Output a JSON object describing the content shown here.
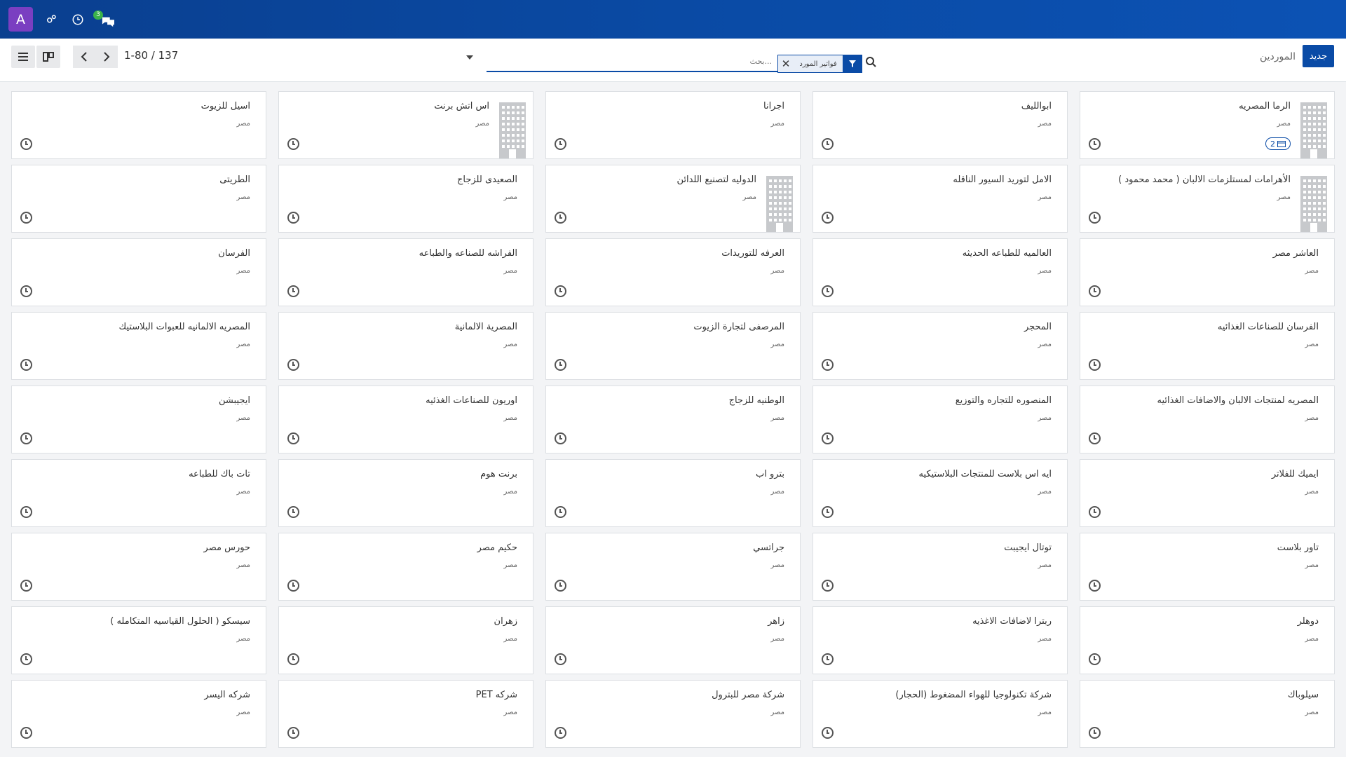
{
  "navbar": {
    "avatar_letter": "A",
    "message_count": "3"
  },
  "control": {
    "new_button": "جديد",
    "breadcrumb": "الموردين",
    "pager_value": "1-80 / 137",
    "search_placeholder": "بحث...",
    "facet_label": "فواتير المورد"
  },
  "card_default_subtitle": "مصر",
  "cards": [
    {
      "title": "الرما المصريه",
      "subtitle": "مصر",
      "has_image": true,
      "badge": "2"
    },
    {
      "title": "ابوالليف",
      "subtitle": "مصر",
      "has_image": false
    },
    {
      "title": "اجرانا",
      "subtitle": "مصر",
      "has_image": false
    },
    {
      "title": "اس اتش برنت",
      "subtitle": "مصر",
      "has_image": true
    },
    {
      "title": "اسيل للزيوت",
      "subtitle": "مصر",
      "has_image": false
    },
    {
      "title": "الأهرامات لمستلزمات الالبان ( محمد محمود )",
      "subtitle": "مصر",
      "has_image": true
    },
    {
      "title": "الامل لتوريد السيور الناقله",
      "subtitle": "مصر",
      "has_image": false
    },
    {
      "title": "الدوليه لتصنيع اللدائن",
      "subtitle": "مصر",
      "has_image": true
    },
    {
      "title": "الصعيدى للزجاج",
      "subtitle": "مصر",
      "has_image": false
    },
    {
      "title": "الطريتى",
      "subtitle": "مصر",
      "has_image": false
    },
    {
      "title": "العاشر مصر",
      "subtitle": "مصر",
      "has_image": false
    },
    {
      "title": "العالميه للطباعه الحديثه",
      "subtitle": "مصر",
      "has_image": false
    },
    {
      "title": "العرفه للتوريدات",
      "subtitle": "مصر",
      "has_image": false
    },
    {
      "title": "الفراشه للصناعه والطباعه",
      "subtitle": "مصر",
      "has_image": false
    },
    {
      "title": "الفرسان",
      "subtitle": "مصر",
      "has_image": false
    },
    {
      "title": "الفرسان للصناعات الغذائيه",
      "subtitle": "مصر",
      "has_image": false
    },
    {
      "title": "المحجر",
      "subtitle": "مصر",
      "has_image": false
    },
    {
      "title": "المرصفى لتجارة الزيوت",
      "subtitle": "مصر",
      "has_image": false
    },
    {
      "title": "المصرية الالمانية",
      "subtitle": "مصر",
      "has_image": false
    },
    {
      "title": "المصريه الالمانيه للعبوات البلاستيك",
      "subtitle": "مصر",
      "has_image": false
    },
    {
      "title": "المصريه لمنتجات الالبان والاضافات الغذائيه",
      "subtitle": "مصر",
      "has_image": false
    },
    {
      "title": "المنصوره للتجاره والتوزيع",
      "subtitle": "مصر",
      "has_image": false
    },
    {
      "title": "الوطنيه للزجاج",
      "subtitle": "مصر",
      "has_image": false
    },
    {
      "title": "اوريون للصناعات الغذئيه",
      "subtitle": "مصر",
      "has_image": false
    },
    {
      "title": "ايجيبشن",
      "subtitle": "مصر",
      "has_image": false
    },
    {
      "title": "ايميك للفلاتر",
      "subtitle": "مصر",
      "has_image": false
    },
    {
      "title": "ايه اس بلاست للمنتجات البلاستيكيه",
      "subtitle": "مصر",
      "has_image": false
    },
    {
      "title": "بترو اب",
      "subtitle": "مصر",
      "has_image": false
    },
    {
      "title": "برنت هوم",
      "subtitle": "مصر",
      "has_image": false
    },
    {
      "title": "تات باك للطباعه",
      "subtitle": "مصر",
      "has_image": false
    },
    {
      "title": "تاور بلاست",
      "subtitle": "مصر",
      "has_image": false
    },
    {
      "title": "توتال ايجيبت",
      "subtitle": "مصر",
      "has_image": false
    },
    {
      "title": "جراتسي",
      "subtitle": "مصر",
      "has_image": false
    },
    {
      "title": "حكيم مصر",
      "subtitle": "مصر",
      "has_image": false
    },
    {
      "title": "حورس مصر",
      "subtitle": "مصر",
      "has_image": false
    },
    {
      "title": "دوهلر",
      "subtitle": "مصر",
      "has_image": false
    },
    {
      "title": "ربترا لاضافات الاغذيه",
      "subtitle": "مصر",
      "has_image": false
    },
    {
      "title": "زاهر",
      "subtitle": "مصر",
      "has_image": false
    },
    {
      "title": "زهران",
      "subtitle": "مصر",
      "has_image": false
    },
    {
      "title": "سيسكو ( الحلول القياسيه المتكامله )",
      "subtitle": "مصر",
      "has_image": false
    },
    {
      "title": "سيلوباك",
      "subtitle": "مصر",
      "has_image": false
    },
    {
      "title": "شركة تكنولوجيا للهواء المضغوط (الحجار)",
      "subtitle": "مصر",
      "has_image": false
    },
    {
      "title": "شركة مصر للبترول",
      "subtitle": "مصر",
      "has_image": false
    },
    {
      "title": "شركه PET",
      "subtitle": "مصر",
      "has_image": false
    },
    {
      "title": "شركه اليسر",
      "subtitle": "مصر",
      "has_image": false
    }
  ]
}
